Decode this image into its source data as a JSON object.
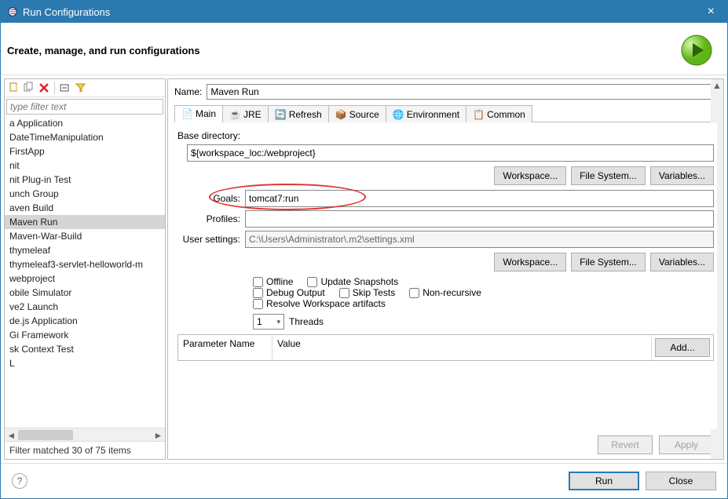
{
  "titlebar": {
    "title": "Run Configurations"
  },
  "header": {
    "heading": "Create, manage, and run configurations"
  },
  "left": {
    "filter_placeholder": "type filter text",
    "items": [
      "a Application",
      "DateTimeManipulation",
      "FirstApp",
      "nit",
      "nit Plug-in Test",
      "unch Group",
      "aven Build",
      "Maven Run",
      "Maven-War-Build",
      "thymeleaf",
      "thymeleaf3-servlet-helloworld-m",
      "webproject",
      "obile Simulator",
      "ve2 Launch",
      "de.js Application",
      "Gi Framework",
      "sk Context Test",
      "L"
    ],
    "selected_index": 7,
    "status": "Filter matched 30 of 75 items"
  },
  "right": {
    "name_label": "Name:",
    "name_value": "Maven Run",
    "tabs": [
      "Main",
      "JRE",
      "Refresh",
      "Source",
      "Environment",
      "Common"
    ],
    "active_tab": 0,
    "base_dir_label": "Base directory:",
    "base_dir_value": "${workspace_loc:/webproject}",
    "btn_workspace": "Workspace...",
    "btn_filesystem": "File System...",
    "btn_variables": "Variables...",
    "goals_label": "Goals:",
    "goals_value": "tomcat7:run",
    "profiles_label": "Profiles:",
    "profiles_value": "",
    "usersettings_label": "User settings:",
    "usersettings_value": "C:\\Users\\Administrator\\.m2\\settings.xml",
    "checks": {
      "offline": "Offline",
      "update": "Update Snapshots",
      "debug": "Debug Output",
      "skip": "Skip Tests",
      "nonrec": "Non-recursive",
      "resolve": "Resolve Workspace artifacts"
    },
    "threads_value": "1",
    "threads_label": "Threads",
    "param_name": "Parameter Name",
    "param_value": "Value",
    "btn_add": "Add...",
    "btn_revert": "Revert",
    "btn_apply": "Apply"
  },
  "footer": {
    "run": "Run",
    "close": "Close"
  }
}
